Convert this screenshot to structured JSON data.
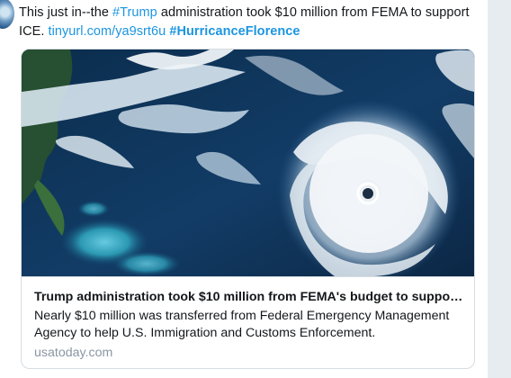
{
  "tweet": {
    "text_plain_1": "This just in--the ",
    "hashtag_trump": "#Trump",
    "text_plain_2": " administration took $10 million from FEMA to support ICE. ",
    "link_text": "tinyurl.com/ya9srt6u",
    "text_space": " ",
    "hashtag_florence": "#HurricanceFlorence"
  },
  "card": {
    "image_alt": "Satellite image of a hurricane over the Atlantic",
    "title": "Trump administration took $10 million from FEMA's budget to suppor…",
    "description": "Nearly $10 million was transferred from Federal Emergency Management Agency to help U.S. Immigration and Customs Enforcement.",
    "domain": "usatoday.com"
  },
  "colors": {
    "link": "#1b95e0",
    "text": "#14171a",
    "muted": "#8a96a3",
    "border": "#d7dde2",
    "background": "#e6ecf0"
  }
}
